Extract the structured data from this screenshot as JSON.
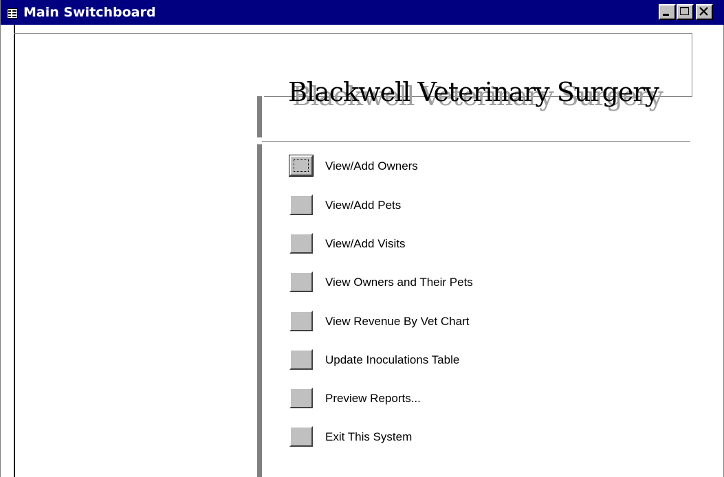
{
  "window": {
    "title": "Main Switchboard",
    "titlebar_color": "#000080",
    "background": "#ffffff"
  },
  "controls": {
    "minimize_icon": "minimize-icon",
    "maximize_icon": "maximize-icon",
    "close_icon": "close-icon"
  },
  "form": {
    "heading": "Blackwell Veterinary Surgery"
  },
  "menu": {
    "items": [
      {
        "label": "View/Add Owners",
        "focused": true
      },
      {
        "label": "View/Add Pets"
      },
      {
        "label": "View/Add Visits"
      },
      {
        "label": "View Owners and Their Pets"
      },
      {
        "label": "View Revenue By Vet Chart"
      },
      {
        "label": "Update Inoculations Table"
      },
      {
        "label": "Preview Reports..."
      },
      {
        "label": "Exit This System"
      }
    ]
  }
}
